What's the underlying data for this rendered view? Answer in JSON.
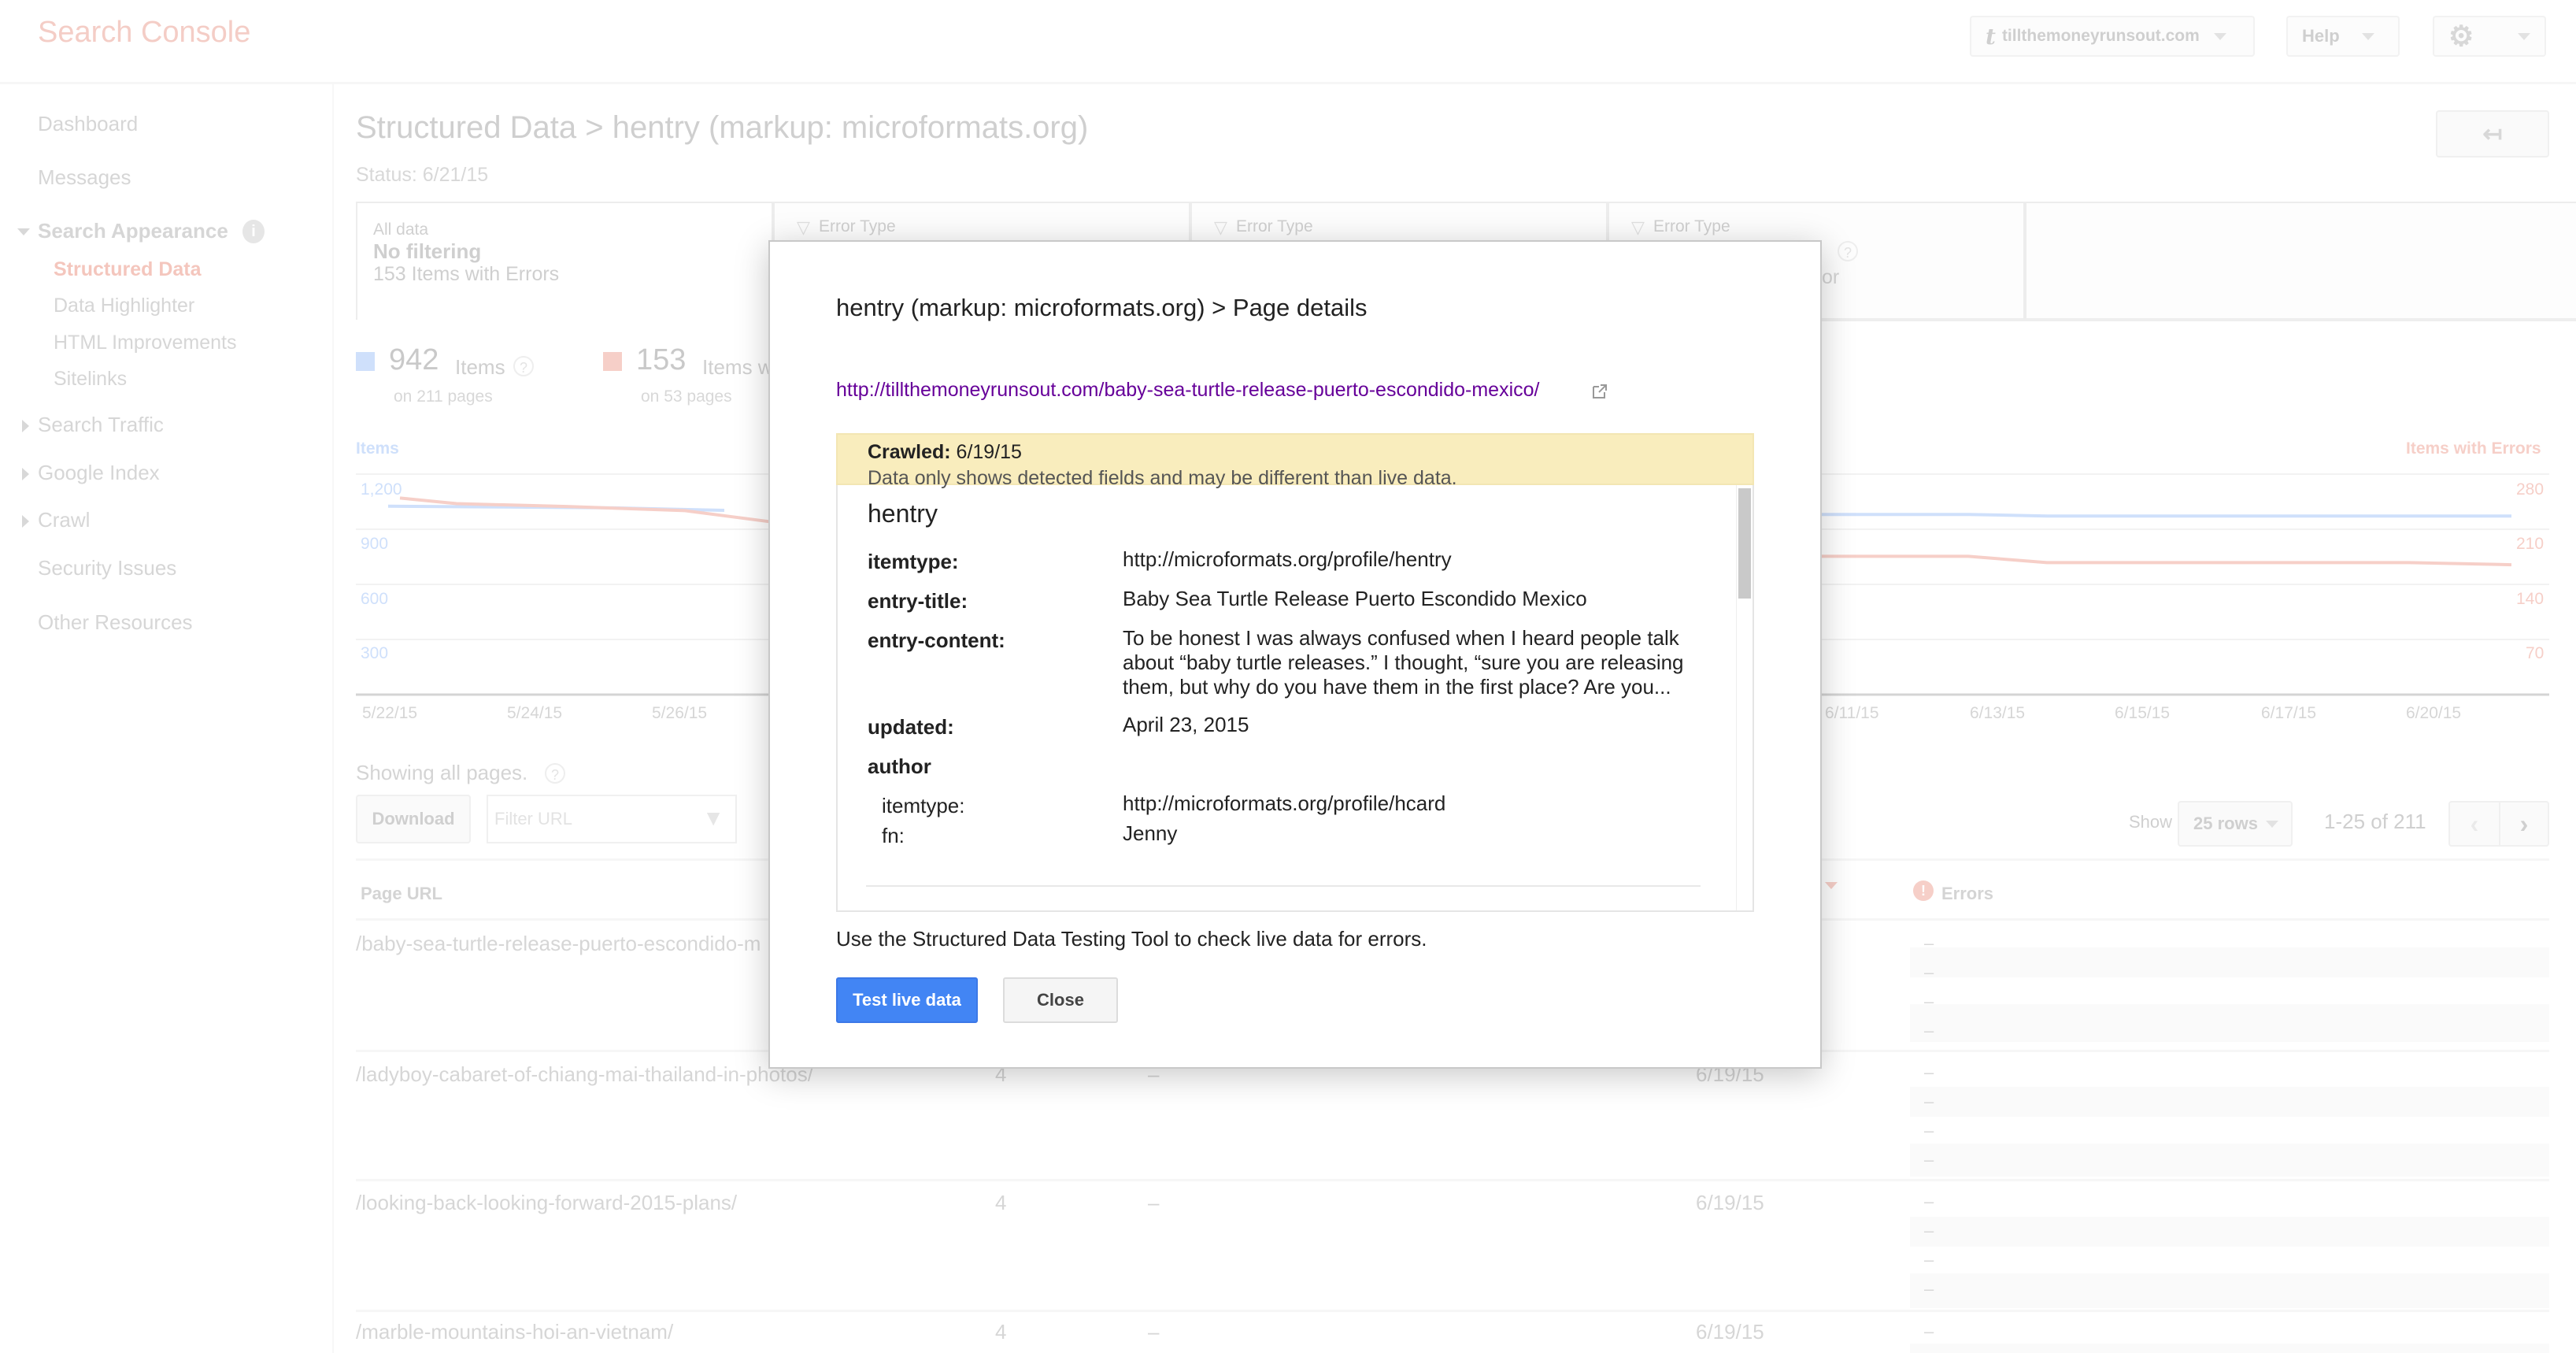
{
  "app": {
    "title": "Search Console"
  },
  "topbar": {
    "site_label": "tillthemoneyrunsout.com",
    "help_label": "Help"
  },
  "sidebar": {
    "items": [
      {
        "label": "Dashboard"
      },
      {
        "label": "Messages"
      },
      {
        "label": "Search Appearance",
        "expanded": true
      },
      {
        "label": "Structured Data",
        "active": true
      },
      {
        "label": "Data Highlighter"
      },
      {
        "label": "HTML Improvements"
      },
      {
        "label": "Sitelinks"
      },
      {
        "label": "Search Traffic"
      },
      {
        "label": "Google Index"
      },
      {
        "label": "Crawl"
      },
      {
        "label": "Security Issues"
      },
      {
        "label": "Other Resources"
      }
    ]
  },
  "page": {
    "title": "Structured Data > hentry (markup: microformats.org)",
    "status": "Status: 6/21/15",
    "tabs": [
      {
        "line1": "All data",
        "line2": "No filtering",
        "line3": "153 Items with Errors"
      },
      {
        "line1": "Error Type"
      },
      {
        "line1": "Error Type"
      },
      {
        "line1": "Error Type",
        "partial": "or"
      }
    ],
    "summary": [
      {
        "count": "942",
        "label": "Items",
        "sub": "on 211 pages",
        "color": "#cfe0fb"
      },
      {
        "count": "153",
        "label": "Items w",
        "sub": "on 53 pages",
        "color": "#f6cfc8"
      }
    ],
    "showing": "Showing all pages.",
    "download_label": "Download",
    "filter_placeholder": "Filter URL",
    "show_label": "Show",
    "rows_select": "25 rows",
    "pagination": "1-25 of 211",
    "table": {
      "headers": {
        "url": "Page URL",
        "errors": "Errors"
      },
      "rows": [
        {
          "url": "/baby-sea-turtle-release-puerto-escondido-m",
          "items": "",
          "errors_col": "",
          "date": ""
        },
        {
          "url": "/ladyboy-cabaret-of-chiang-mai-thailand-in-photos/",
          "items": "4",
          "errors_col": "–",
          "date": "6/19/15"
        },
        {
          "url": "/looking-back-looking-forward-2015-plans/",
          "items": "4",
          "errors_col": "–",
          "date": "6/19/15"
        },
        {
          "url": "/marble-mountains-hoi-an-vietnam/",
          "items": "4",
          "errors_col": "–",
          "date": "6/19/15"
        }
      ],
      "error_dash": "–"
    }
  },
  "chart_data": {
    "type": "line",
    "x": [
      "5/22/15",
      "5/24/15",
      "5/26/15",
      "6/11/15",
      "6/13/15",
      "6/15/15",
      "6/17/15",
      "6/20/15"
    ],
    "left_axis": {
      "title": "Items",
      "ticks": [
        "1,200",
        "900",
        "600",
        "300"
      ],
      "range": [
        0,
        1500
      ]
    },
    "right_axis": {
      "title": "Items with Errors",
      "ticks": [
        "280",
        "210",
        "140",
        "70"
      ],
      "range": [
        0,
        350
      ]
    },
    "series": [
      {
        "name": "Items",
        "color": "#cfe0fb",
        "axis": "left",
        "values_start": [
          1150,
          1145,
          1140,
          1125
        ],
        "values_end": [
          1100,
          1100,
          1090,
          1090,
          1090,
          1090
        ]
      },
      {
        "name": "Items with Errors",
        "color": "#f6cfc8",
        "axis": "right",
        "values_start": [
          280,
          272,
          268,
          262,
          246
        ],
        "values_end": [
          197,
          197,
          188,
          188,
          188,
          185
        ]
      }
    ],
    "grid": true
  },
  "modal": {
    "title": "hentry (markup: microformats.org) > Page details",
    "url": "http://tillthemoneyrunsout.com/baby-sea-turtle-release-puerto-escondido-mexico/",
    "crawled_label": "Crawled:",
    "crawled_date": "6/19/15",
    "crawled_note": "Data only shows detected fields and may be different than live data.",
    "section": "hentry",
    "fields": [
      {
        "key": "itemtype:",
        "value": "http://microformats.org/profile/hentry"
      },
      {
        "key": "entry-title:",
        "value": "Baby Sea Turtle Release Puerto Escondido Mexico"
      },
      {
        "key": "entry-content:",
        "value": "To be honest I was always confused when I heard people talk about “baby turtle releases.” I thought, “sure you are releasing them, but why do you have them in the first place? Are you..."
      },
      {
        "key": "updated:",
        "value": "April 23, 2015"
      }
    ],
    "author": {
      "label": "author",
      "fields": [
        {
          "key": "itemtype:",
          "value": "http://microformats.org/profile/hcard"
        },
        {
          "key": "fn:",
          "value": "Jenny"
        }
      ]
    },
    "footer_text": "Use the Structured Data Testing Tool to check live data for errors.",
    "primary_button": "Test live data",
    "secondary_button": "Close"
  }
}
